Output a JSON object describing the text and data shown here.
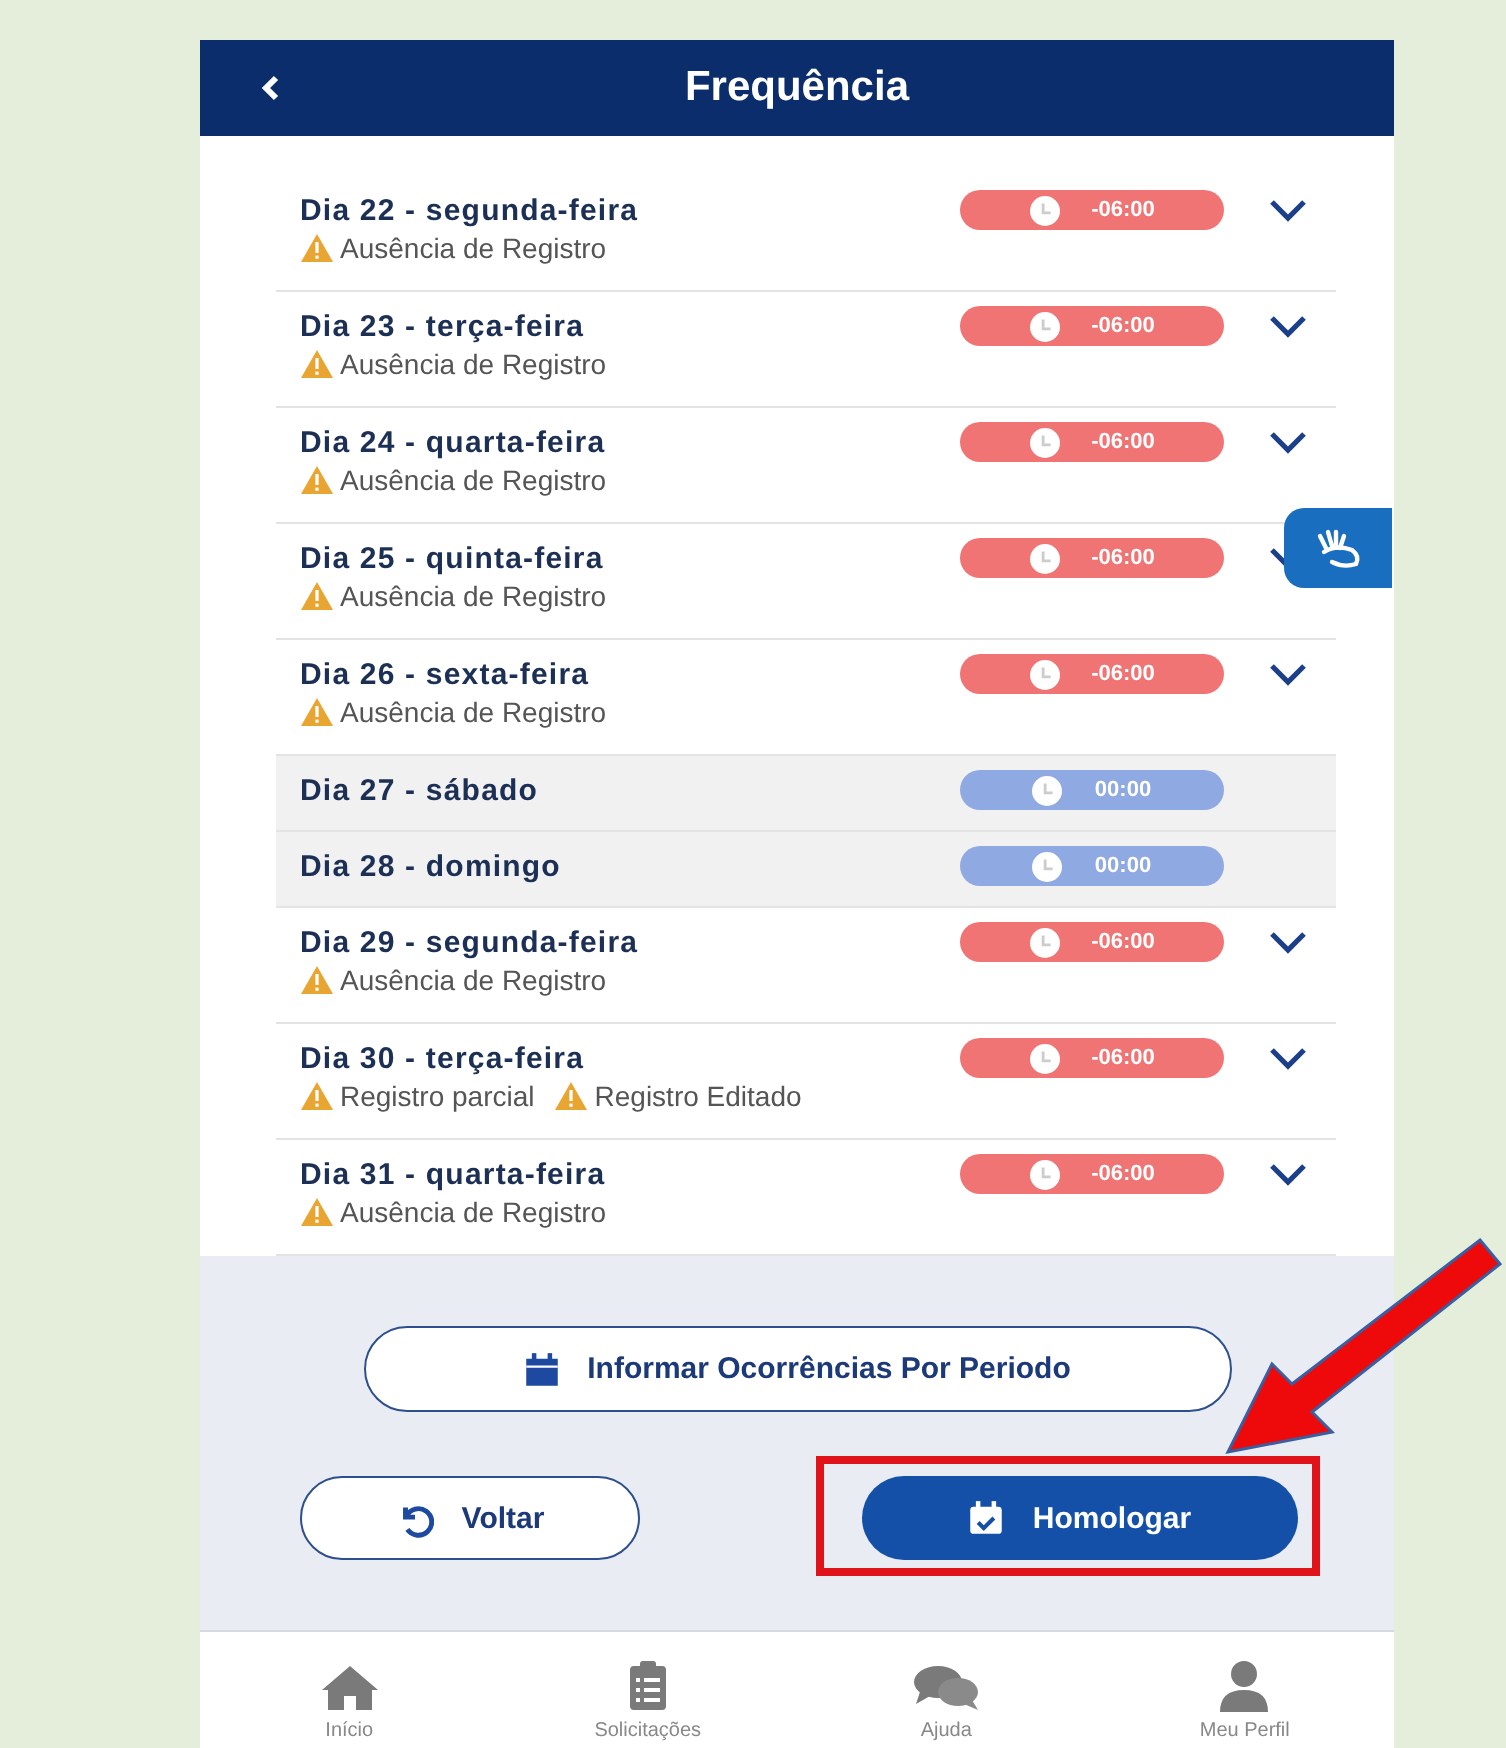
{
  "header": {
    "title": "Frequência"
  },
  "days": [
    {
      "label": "Dia 22 - segunda-feira",
      "kind": "weekday",
      "balance": "-06:00",
      "color": "#f07474",
      "alerts": [
        "Ausência de Registro"
      ]
    },
    {
      "label": "Dia 23 - terça-feira",
      "kind": "weekday",
      "balance": "-06:00",
      "color": "#f07474",
      "alerts": [
        "Ausência de Registro"
      ]
    },
    {
      "label": "Dia 24 - quarta-feira",
      "kind": "weekday",
      "balance": "-06:00",
      "color": "#f07474",
      "alerts": [
        "Ausência de Registro"
      ]
    },
    {
      "label": "Dia 25 - quinta-feira",
      "kind": "weekday",
      "balance": "-06:00",
      "color": "#f07474",
      "alerts": [
        "Ausência de Registro"
      ]
    },
    {
      "label": "Dia 26 - sexta-feira",
      "kind": "weekday",
      "balance": "-06:00",
      "color": "#f07474",
      "alerts": [
        "Ausência de Registro"
      ]
    },
    {
      "label": "Dia 27 - sábado",
      "kind": "weekend",
      "balance": "00:00",
      "color": "#8fa9e3"
    },
    {
      "label": "Dia 28 - domingo",
      "kind": "weekend",
      "balance": "00:00",
      "color": "#8fa9e3"
    },
    {
      "label": "Dia 29 - segunda-feira",
      "kind": "weekday",
      "balance": "-06:00",
      "color": "#f07474",
      "alerts": [
        "Ausência de Registro"
      ]
    },
    {
      "label": "Dia 30 - terça-feira",
      "kind": "weekday",
      "balance": "-06:00",
      "color": "#f07474",
      "alerts": [
        "Registro parcial",
        "Registro Editado"
      ]
    },
    {
      "label": "Dia 31 - quarta-feira",
      "kind": "weekday",
      "balance": "-06:00",
      "color": "#f07474",
      "alerts": [
        "Ausência de Registro"
      ]
    }
  ],
  "period_button": {
    "label": "Informar Ocorrências Por Periodo"
  },
  "back_button": {
    "label": "Voltar"
  },
  "approve_button": {
    "label": "Homologar"
  },
  "bottom_nav": [
    {
      "label": "Início",
      "kind": "home"
    },
    {
      "label": "Solicitações",
      "kind": "requests"
    },
    {
      "label": "Ajuda",
      "kind": "help"
    },
    {
      "label": "Meu Perfil",
      "kind": "profile"
    }
  ]
}
